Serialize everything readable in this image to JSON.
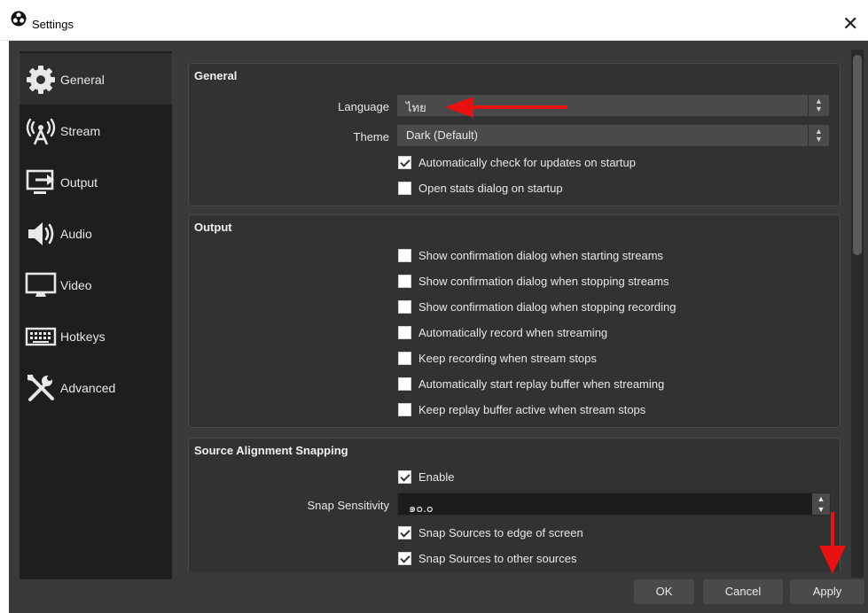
{
  "window": {
    "title": "Settings",
    "close_glyph": "✕"
  },
  "sidebar": {
    "items": [
      {
        "label": "General",
        "icon": "gear-icon",
        "active": true
      },
      {
        "label": "Stream",
        "icon": "antenna-icon"
      },
      {
        "label": "Output",
        "icon": "monitor-output-icon"
      },
      {
        "label": "Audio",
        "icon": "speaker-icon"
      },
      {
        "label": "Video",
        "icon": "monitor-icon"
      },
      {
        "label": "Hotkeys",
        "icon": "keyboard-icon"
      },
      {
        "label": "Advanced",
        "icon": "tools-icon"
      }
    ]
  },
  "general": {
    "title": "General",
    "language_label": "Language",
    "language_value": "ไทย",
    "theme_label": "Theme",
    "theme_value": "Dark (Default)",
    "check_updates": "Automatically check for updates on startup",
    "open_stats": "Open stats dialog on startup"
  },
  "output": {
    "title": "Output",
    "options": [
      "Show confirmation dialog when starting streams",
      "Show confirmation dialog when stopping streams",
      "Show confirmation dialog when stopping recording",
      "Automatically record when streaming",
      "Keep recording when stream stops",
      "Automatically start replay buffer when streaming",
      "Keep replay buffer active when stream stops"
    ]
  },
  "snapping": {
    "title": "Source Alignment Snapping",
    "enable_label": "Enable",
    "sensitivity_label": "Snap Sensitivity",
    "sensitivity_value": "๑๐.๐",
    "edge_label": "Snap Sources to edge of screen",
    "other_label": "Snap Sources to other sources"
  },
  "buttons": {
    "ok": "OK",
    "cancel": "Cancel",
    "apply": "Apply"
  },
  "colors": {
    "accent_arrow": "#e81010",
    "panel_bg": "#323232",
    "sidebar_bg": "#1e1e1e"
  }
}
